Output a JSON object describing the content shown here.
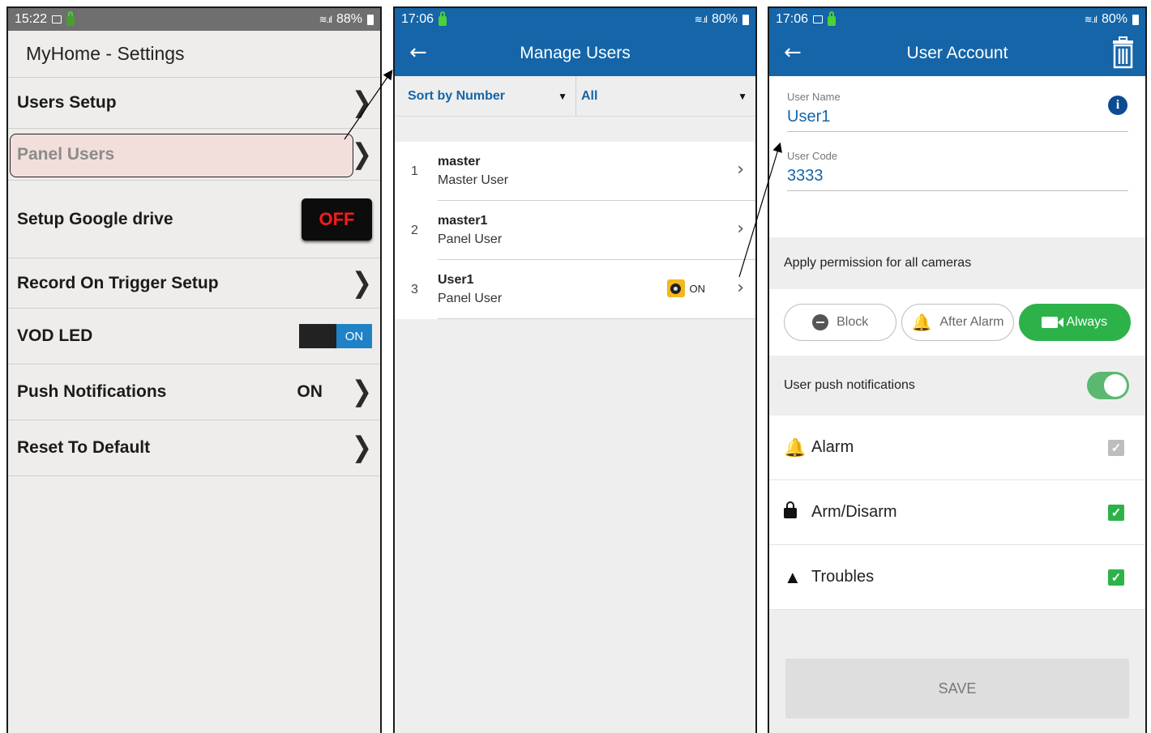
{
  "settings_screen": {
    "status": {
      "time": "15:22",
      "battery": "88%"
    },
    "title": "MyHome - Settings",
    "rows": [
      {
        "label": "Users Setup",
        "control": "chevron"
      },
      {
        "label": "Panel Users",
        "control": "chevron",
        "highlighted": true
      },
      {
        "label": "Setup Google drive",
        "control": "off-button",
        "value": "OFF"
      },
      {
        "label": "Record On Trigger Setup",
        "control": "chevron"
      },
      {
        "label": "VOD LED",
        "control": "toggle",
        "value": "ON"
      },
      {
        "label": "Push Notifications",
        "control": "chevron",
        "value": "ON"
      },
      {
        "label": "Reset To Default",
        "control": "chevron"
      }
    ]
  },
  "manage_users_screen": {
    "status": {
      "time": "17:06",
      "battery": "80%"
    },
    "title": "Manage Users",
    "sort_filter": "Sort by Number",
    "type_filter": "All",
    "users": [
      {
        "number": "1",
        "name": "master",
        "role": "Master User"
      },
      {
        "number": "2",
        "name": "master1",
        "role": "Panel User"
      },
      {
        "number": "3",
        "name": "User1",
        "role": "Panel User",
        "camera_badge": "ON"
      }
    ]
  },
  "user_account_screen": {
    "status": {
      "time": "17:06",
      "battery": "80%"
    },
    "title": "User Account",
    "user_name_label": "User Name",
    "user_name_value": "User1",
    "user_code_label": "User Code",
    "user_code_value": "3333",
    "camera_permission_label": "Apply permission for all cameras",
    "permission_options": [
      {
        "label": "Block",
        "icon": "block-icon",
        "selected": false
      },
      {
        "label": "After Alarm",
        "icon": "bell-icon",
        "selected": false
      },
      {
        "label": "Always",
        "icon": "video-camera-icon",
        "selected": true
      }
    ],
    "push_label": "User push notifications",
    "push_enabled": true,
    "notifications": [
      {
        "label": "Alarm",
        "icon": "alarm-bell-icon",
        "checked": true,
        "enabled": false
      },
      {
        "label": "Arm/Disarm",
        "icon": "lock-icon",
        "checked": true,
        "enabled": true
      },
      {
        "label": "Troubles",
        "icon": "warning-icon",
        "checked": true,
        "enabled": true
      }
    ],
    "save_label": "SAVE"
  },
  "colors": {
    "app_blue": "#1565a8",
    "active_green": "#2db24a",
    "off_red": "#ff1a1a"
  }
}
